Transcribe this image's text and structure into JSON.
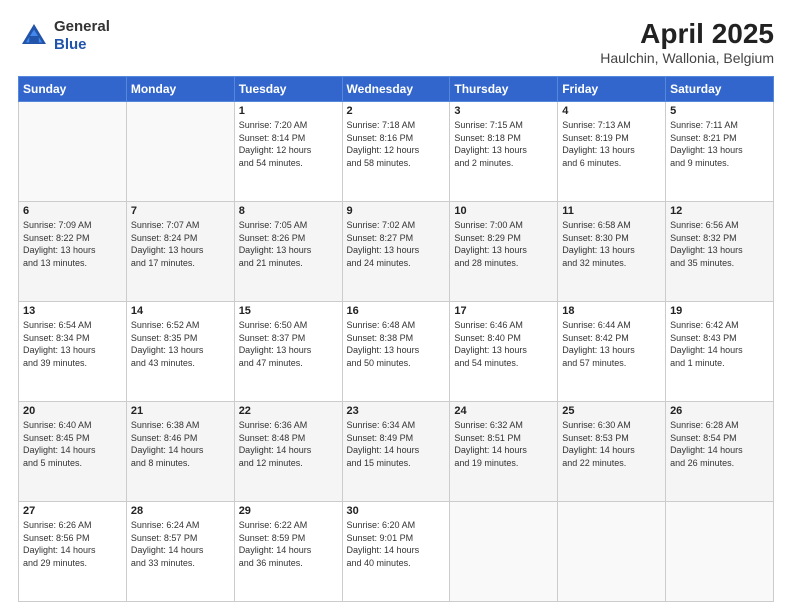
{
  "logo": {
    "general": "General",
    "blue": "Blue"
  },
  "header": {
    "title": "April 2025",
    "subtitle": "Haulchin, Wallonia, Belgium"
  },
  "days_of_week": [
    "Sunday",
    "Monday",
    "Tuesday",
    "Wednesday",
    "Thursday",
    "Friday",
    "Saturday"
  ],
  "weeks": [
    [
      {
        "day": "",
        "info": ""
      },
      {
        "day": "",
        "info": ""
      },
      {
        "day": "1",
        "info": "Sunrise: 7:20 AM\nSunset: 8:14 PM\nDaylight: 12 hours\nand 54 minutes."
      },
      {
        "day": "2",
        "info": "Sunrise: 7:18 AM\nSunset: 8:16 PM\nDaylight: 12 hours\nand 58 minutes."
      },
      {
        "day": "3",
        "info": "Sunrise: 7:15 AM\nSunset: 8:18 PM\nDaylight: 13 hours\nand 2 minutes."
      },
      {
        "day": "4",
        "info": "Sunrise: 7:13 AM\nSunset: 8:19 PM\nDaylight: 13 hours\nand 6 minutes."
      },
      {
        "day": "5",
        "info": "Sunrise: 7:11 AM\nSunset: 8:21 PM\nDaylight: 13 hours\nand 9 minutes."
      }
    ],
    [
      {
        "day": "6",
        "info": "Sunrise: 7:09 AM\nSunset: 8:22 PM\nDaylight: 13 hours\nand 13 minutes."
      },
      {
        "day": "7",
        "info": "Sunrise: 7:07 AM\nSunset: 8:24 PM\nDaylight: 13 hours\nand 17 minutes."
      },
      {
        "day": "8",
        "info": "Sunrise: 7:05 AM\nSunset: 8:26 PM\nDaylight: 13 hours\nand 21 minutes."
      },
      {
        "day": "9",
        "info": "Sunrise: 7:02 AM\nSunset: 8:27 PM\nDaylight: 13 hours\nand 24 minutes."
      },
      {
        "day": "10",
        "info": "Sunrise: 7:00 AM\nSunset: 8:29 PM\nDaylight: 13 hours\nand 28 minutes."
      },
      {
        "day": "11",
        "info": "Sunrise: 6:58 AM\nSunset: 8:30 PM\nDaylight: 13 hours\nand 32 minutes."
      },
      {
        "day": "12",
        "info": "Sunrise: 6:56 AM\nSunset: 8:32 PM\nDaylight: 13 hours\nand 35 minutes."
      }
    ],
    [
      {
        "day": "13",
        "info": "Sunrise: 6:54 AM\nSunset: 8:34 PM\nDaylight: 13 hours\nand 39 minutes."
      },
      {
        "day": "14",
        "info": "Sunrise: 6:52 AM\nSunset: 8:35 PM\nDaylight: 13 hours\nand 43 minutes."
      },
      {
        "day": "15",
        "info": "Sunrise: 6:50 AM\nSunset: 8:37 PM\nDaylight: 13 hours\nand 47 minutes."
      },
      {
        "day": "16",
        "info": "Sunrise: 6:48 AM\nSunset: 8:38 PM\nDaylight: 13 hours\nand 50 minutes."
      },
      {
        "day": "17",
        "info": "Sunrise: 6:46 AM\nSunset: 8:40 PM\nDaylight: 13 hours\nand 54 minutes."
      },
      {
        "day": "18",
        "info": "Sunrise: 6:44 AM\nSunset: 8:42 PM\nDaylight: 13 hours\nand 57 minutes."
      },
      {
        "day": "19",
        "info": "Sunrise: 6:42 AM\nSunset: 8:43 PM\nDaylight: 14 hours\nand 1 minute."
      }
    ],
    [
      {
        "day": "20",
        "info": "Sunrise: 6:40 AM\nSunset: 8:45 PM\nDaylight: 14 hours\nand 5 minutes."
      },
      {
        "day": "21",
        "info": "Sunrise: 6:38 AM\nSunset: 8:46 PM\nDaylight: 14 hours\nand 8 minutes."
      },
      {
        "day": "22",
        "info": "Sunrise: 6:36 AM\nSunset: 8:48 PM\nDaylight: 14 hours\nand 12 minutes."
      },
      {
        "day": "23",
        "info": "Sunrise: 6:34 AM\nSunset: 8:49 PM\nDaylight: 14 hours\nand 15 minutes."
      },
      {
        "day": "24",
        "info": "Sunrise: 6:32 AM\nSunset: 8:51 PM\nDaylight: 14 hours\nand 19 minutes."
      },
      {
        "day": "25",
        "info": "Sunrise: 6:30 AM\nSunset: 8:53 PM\nDaylight: 14 hours\nand 22 minutes."
      },
      {
        "day": "26",
        "info": "Sunrise: 6:28 AM\nSunset: 8:54 PM\nDaylight: 14 hours\nand 26 minutes."
      }
    ],
    [
      {
        "day": "27",
        "info": "Sunrise: 6:26 AM\nSunset: 8:56 PM\nDaylight: 14 hours\nand 29 minutes."
      },
      {
        "day": "28",
        "info": "Sunrise: 6:24 AM\nSunset: 8:57 PM\nDaylight: 14 hours\nand 33 minutes."
      },
      {
        "day": "29",
        "info": "Sunrise: 6:22 AM\nSunset: 8:59 PM\nDaylight: 14 hours\nand 36 minutes."
      },
      {
        "day": "30",
        "info": "Sunrise: 6:20 AM\nSunset: 9:01 PM\nDaylight: 14 hours\nand 40 minutes."
      },
      {
        "day": "",
        "info": ""
      },
      {
        "day": "",
        "info": ""
      },
      {
        "day": "",
        "info": ""
      }
    ]
  ]
}
